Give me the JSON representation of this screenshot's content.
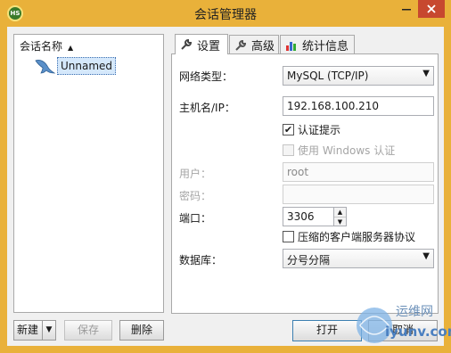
{
  "window": {
    "title": "会话管理器",
    "app_icon_text": "HS"
  },
  "tree": {
    "column_header": "会话名称",
    "items": [
      {
        "label": "Unnamed"
      }
    ]
  },
  "left_buttons": {
    "new": "新建",
    "save": "保存",
    "delete": "删除"
  },
  "tabs": [
    {
      "label": "设置",
      "icon": "wrench-icon",
      "active": true
    },
    {
      "label": "高级",
      "icon": "wrench-icon",
      "active": false
    },
    {
      "label": "统计信息",
      "icon": "bar-chart-icon",
      "active": false
    }
  ],
  "settings": {
    "network_type": {
      "label": "网络类型：",
      "value": "MySQL (TCP/IP)"
    },
    "host": {
      "label": "主机名/IP：",
      "value": "192.168.100.210"
    },
    "auth_prompt": {
      "label": "认证提示",
      "checked": true
    },
    "windows_auth": {
      "label": "使用 Windows 认证",
      "checked": false,
      "disabled": true
    },
    "user": {
      "label": "用户：",
      "value": "root"
    },
    "password": {
      "label": "密码：",
      "value": ""
    },
    "port": {
      "label": "端口：",
      "value": "3306"
    },
    "compress": {
      "label": "压缩的客户端服务器协议",
      "checked": false
    },
    "database": {
      "label": "数据库：",
      "value": "分号分隔"
    }
  },
  "bottom_buttons": {
    "open": "打开",
    "cancel": "取消"
  },
  "watermark": {
    "text": "运维网",
    "url": "iyunv.com"
  },
  "colors": {
    "frame": "#e9b13a",
    "close": "#c7482f",
    "selection": "#d5e8fb"
  }
}
